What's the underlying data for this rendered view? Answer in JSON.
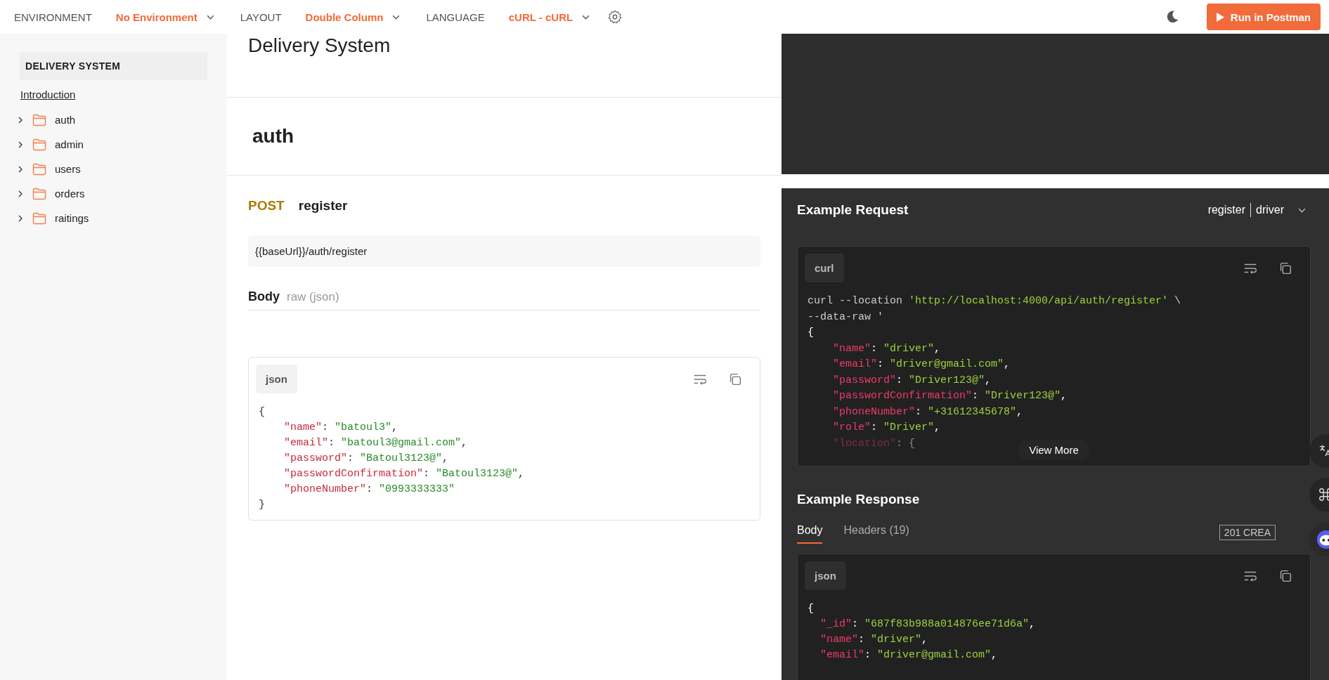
{
  "toolbar": {
    "items": [
      {
        "kind": "label",
        "text": "ENVIRONMENT"
      },
      {
        "kind": "dropdown",
        "text": "No Environment"
      },
      {
        "kind": "label",
        "text": "LAYOUT"
      },
      {
        "kind": "dropdown",
        "text": "Double Column"
      },
      {
        "kind": "label",
        "text": "LANGUAGE"
      },
      {
        "kind": "dropdown",
        "text": "cURL - cURL"
      }
    ],
    "run_button": "Run in Postman"
  },
  "sidebar": {
    "collection": "DELIVERY SYSTEM",
    "introduction": "Introduction",
    "folders": [
      {
        "label": "auth",
        "expanded": false
      },
      {
        "label": "admin",
        "expanded": false
      },
      {
        "label": "users",
        "expanded": false
      },
      {
        "label": "orders",
        "expanded": false
      },
      {
        "label": "raitings",
        "expanded": false
      }
    ]
  },
  "document": {
    "title": "Delivery System",
    "folder": "auth",
    "request": {
      "method": "POST",
      "name": "register",
      "url": "{{baseUrl}}/auth/register",
      "body_label": "Body",
      "body_mode": "raw (json)",
      "code_language": "json",
      "code": [
        {
          "tokens": [
            {
              "kind": "punct",
              "text": "{"
            }
          ]
        },
        {
          "tokens": [
            {
              "kind": "key",
              "text": "    \"name\""
            },
            {
              "kind": "punct",
              "text": ": "
            },
            {
              "kind": "string",
              "text": "\"batoul3\""
            },
            {
              "kind": "punct",
              "text": ","
            }
          ]
        },
        {
          "tokens": [
            {
              "kind": "key",
              "text": "    \"email\""
            },
            {
              "kind": "punct",
              "text": ": "
            },
            {
              "kind": "string",
              "text": "\"batoul3@gmail.com\""
            },
            {
              "kind": "punct",
              "text": ","
            }
          ]
        },
        {
          "tokens": [
            {
              "kind": "key",
              "text": "    \"password\""
            },
            {
              "kind": "punct",
              "text": ": "
            },
            {
              "kind": "string",
              "text": "\"Batoul3123@\""
            },
            {
              "kind": "punct",
              "text": ","
            }
          ]
        },
        {
          "tokens": [
            {
              "kind": "key",
              "text": "    \"passwordConfirmation\""
            },
            {
              "kind": "punct",
              "text": ": "
            },
            {
              "kind": "string",
              "text": "\"Batoul3123@\""
            },
            {
              "kind": "punct",
              "text": ","
            }
          ]
        },
        {
          "tokens": [
            {
              "kind": "key",
              "text": "    \"phoneNumber\""
            },
            {
              "kind": "punct",
              "text": ": "
            },
            {
              "kind": "string",
              "text": "\"0993333333\""
            }
          ]
        },
        {
          "tokens": [
            {
              "kind": "punct",
              "text": "}"
            }
          ]
        }
      ]
    }
  },
  "example_request": {
    "title": "Example Request",
    "example": "register",
    "variant": "driver",
    "code_language": "curl",
    "view_more": "View More",
    "code": [
      {
        "tokens": [
          {
            "kind": "plain",
            "text": "curl --location "
          },
          {
            "kind": "string",
            "text": "'http://localhost:4000/api/auth/register'"
          },
          {
            "kind": "plain",
            "text": " \\"
          }
        ]
      },
      {
        "tokens": [
          {
            "kind": "plain",
            "text": "--data-raw '"
          }
        ]
      },
      {
        "tokens": [
          {
            "kind": "punct",
            "text": "{"
          }
        ]
      },
      {
        "tokens": [
          {
            "kind": "key",
            "text": "    \"name\""
          },
          {
            "kind": "punct",
            "text": ": "
          },
          {
            "kind": "string",
            "text": "\"driver\""
          },
          {
            "kind": "punct",
            "text": ","
          }
        ]
      },
      {
        "tokens": [
          {
            "kind": "key",
            "text": "    \"email\""
          },
          {
            "kind": "punct",
            "text": ": "
          },
          {
            "kind": "string",
            "text": "\"driver@gmail.com\""
          },
          {
            "kind": "punct",
            "text": ","
          }
        ]
      },
      {
        "tokens": [
          {
            "kind": "key",
            "text": "    \"password\""
          },
          {
            "kind": "punct",
            "text": ": "
          },
          {
            "kind": "string",
            "text": "\"Driver123@\""
          },
          {
            "kind": "punct",
            "text": ","
          }
        ]
      },
      {
        "tokens": [
          {
            "kind": "key",
            "text": "    \"passwordConfirmation\""
          },
          {
            "kind": "punct",
            "text": ": "
          },
          {
            "kind": "string",
            "text": "\"Driver123@\""
          },
          {
            "kind": "punct",
            "text": ","
          }
        ]
      },
      {
        "tokens": [
          {
            "kind": "key",
            "text": "    \"phoneNumber\""
          },
          {
            "kind": "punct",
            "text": ": "
          },
          {
            "kind": "string",
            "text": "\"+31612345678\""
          },
          {
            "kind": "punct",
            "text": ","
          }
        ]
      },
      {
        "tokens": [
          {
            "kind": "key",
            "text": "    \"role\""
          },
          {
            "kind": "punct",
            "text": ": "
          },
          {
            "kind": "string",
            "text": "\"Driver\""
          },
          {
            "kind": "punct",
            "text": ","
          }
        ]
      },
      {
        "tokens": [
          {
            "kind": "key",
            "text": "    \"location\""
          },
          {
            "kind": "punct",
            "text": ": {"
          }
        ]
      }
    ]
  },
  "example_response": {
    "title": "Example Response",
    "tabs": [
      {
        "label": "Body",
        "selected": true
      },
      {
        "label": "Headers (19)",
        "selected": false
      }
    ],
    "status": "201 CREA",
    "code_language": "json",
    "code": [
      {
        "tokens": [
          {
            "kind": "punct",
            "text": "{"
          }
        ]
      },
      {
        "tokens": [
          {
            "kind": "key",
            "text": "  \"_id\""
          },
          {
            "kind": "punct",
            "text": ": "
          },
          {
            "kind": "string",
            "text": "\"687f83b988a014876ee71d6a\""
          },
          {
            "kind": "punct",
            "text": ","
          }
        ]
      },
      {
        "tokens": [
          {
            "kind": "key",
            "text": "  \"name\""
          },
          {
            "kind": "punct",
            "text": ": "
          },
          {
            "kind": "string",
            "text": "\"driver\""
          },
          {
            "kind": "punct",
            "text": ","
          }
        ]
      },
      {
        "tokens": [
          {
            "kind": "key",
            "text": "  \"email\""
          },
          {
            "kind": "punct",
            "text": ": "
          },
          {
            "kind": "string",
            "text": "\"driver@gmail.com\""
          },
          {
            "kind": "punct",
            "text": ","
          }
        ]
      }
    ]
  }
}
